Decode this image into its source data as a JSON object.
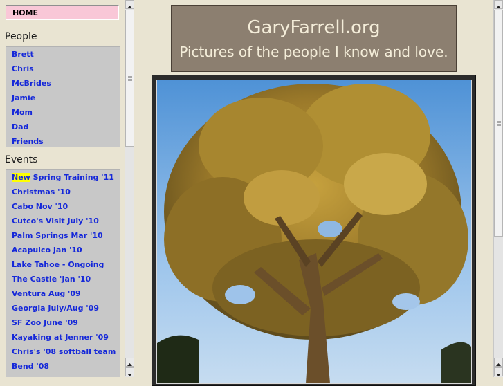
{
  "nav": {
    "home": "HOME",
    "people_title": "People",
    "people": [
      "Brett",
      "Chris",
      "McBrides",
      "Jamie",
      "Mom",
      "Dad",
      "Friends"
    ],
    "events_title": "Events",
    "events_new_tag": "New",
    "events": [
      " Spring Training '11",
      "Christmas '10",
      "Cabo Nov '10",
      "Cutco's Visit July '10",
      "Palm Springs Mar '10",
      "Acapulco Jan '10",
      "Lake Tahoe - Ongoing",
      "The Castle 'Jan '10",
      "Ventura Aug '09",
      "Georgia July/Aug '09",
      "SF Zoo June '09",
      "Kayaking at Jenner '09",
      "Chris's '08 softball team",
      "Bend '08"
    ]
  },
  "banner": {
    "title": "GaryFarrell.org",
    "subtitle": "Pictures of the people I know and love."
  },
  "colors": {
    "page_bg": "#e9e4d2",
    "banner_bg": "#8c7f70",
    "home_bg": "#f9c7d7",
    "menu_bg": "#c8c8c8",
    "link": "#1528d9",
    "new_highlight": "#ffff00"
  },
  "icons": {
    "scroll_up": "triangle-up",
    "scroll_down": "triangle-down"
  }
}
